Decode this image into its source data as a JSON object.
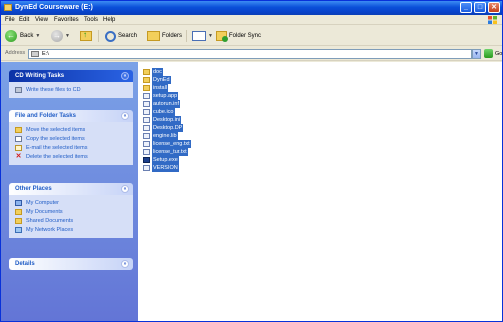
{
  "window": {
    "title": "DynEd Courseware (E:)"
  },
  "menu": [
    "File",
    "Edit",
    "View",
    "Favorites",
    "Tools",
    "Help"
  ],
  "toolbar": {
    "back_label": "Back",
    "search_label": "Search",
    "folders_label": "Folders",
    "folder_sync_label": "Folder Sync"
  },
  "address": {
    "label": "Address",
    "value": "E:\\",
    "go_label": "Go"
  },
  "sidebar": {
    "cd_tasks": {
      "title": "CD Writing Tasks",
      "items": [
        {
          "label": "Write these files to CD",
          "icon": "cd-icon"
        }
      ]
    },
    "file_tasks": {
      "title": "File and Folder Tasks",
      "items": [
        {
          "label": "Move the selected items",
          "icon": "move-icon"
        },
        {
          "label": "Copy the selected items",
          "icon": "copy-icon"
        },
        {
          "label": "E-mail the selected items",
          "icon": "email-icon"
        },
        {
          "label": "Delete the selected items",
          "icon": "delete-icon"
        }
      ]
    },
    "other_places": {
      "title": "Other Places",
      "items": [
        {
          "label": "My Computer",
          "icon": "my-computer-icon"
        },
        {
          "label": "My Documents",
          "icon": "folder-icon"
        },
        {
          "label": "Shared Documents",
          "icon": "folder-icon"
        },
        {
          "label": "My Network Places",
          "icon": "network-icon"
        }
      ]
    },
    "details": {
      "title": "Details"
    }
  },
  "files": [
    {
      "name": "doc",
      "type": "folder"
    },
    {
      "name": "DynEd",
      "type": "folder"
    },
    {
      "name": "install",
      "type": "folder"
    },
    {
      "name": "setup.app",
      "type": "file"
    },
    {
      "name": "autorun.inf",
      "type": "file"
    },
    {
      "name": "cube.ico",
      "type": "file"
    },
    {
      "name": "Desktop.ini",
      "type": "file"
    },
    {
      "name": "Desktop.DP",
      "type": "file"
    },
    {
      "name": "engine.lib",
      "type": "file"
    },
    {
      "name": "license_eng.txt",
      "type": "file"
    },
    {
      "name": "license_tur.txt",
      "type": "file"
    },
    {
      "name": "Setup.exe",
      "type": "exe"
    },
    {
      "name": "VERSION",
      "type": "file"
    }
  ],
  "colors": {
    "titlebar": "#0a4fd9",
    "taskpane": "#6f8cdf",
    "selection": "#316ac5",
    "link": "#215dc6"
  }
}
